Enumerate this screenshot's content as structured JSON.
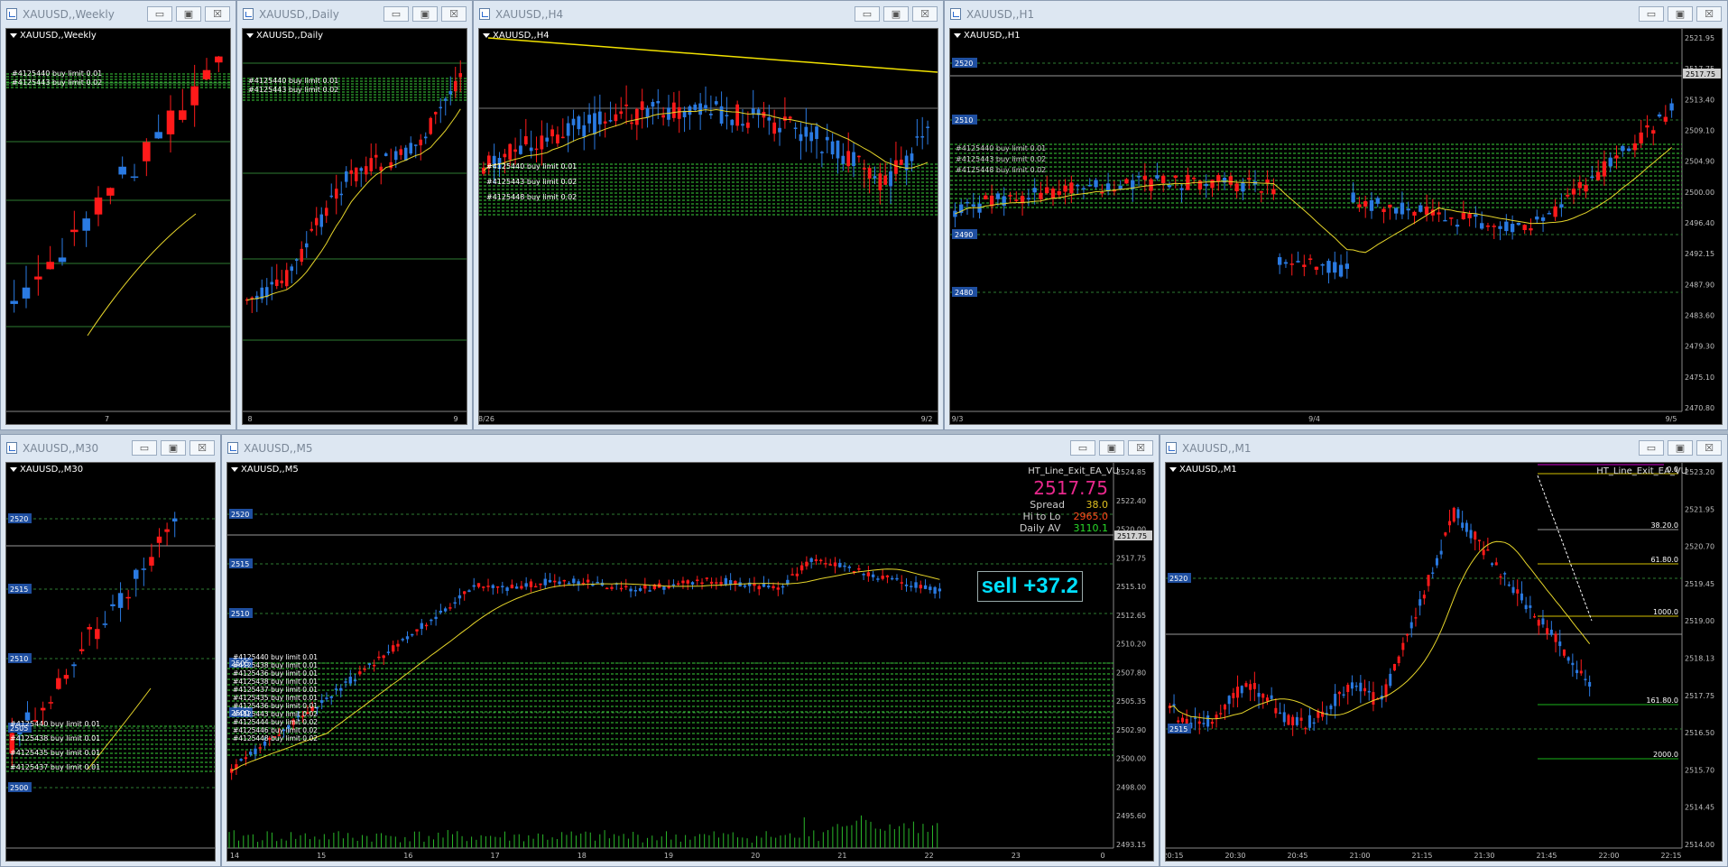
{
  "colors": {
    "bull": "#2a7ae2",
    "bear": "#ff1a1a",
    "grid": "#3a8a3a",
    "ma": "#e6d52a",
    "order_line": "#3aa83a",
    "bg": "#000000",
    "axis_text": "#bfbfbf",
    "price_tag": "#1f4fa0"
  },
  "window_buttons": {
    "minimize": "▭",
    "maximize": "▣",
    "close": "☒"
  },
  "windows": [
    {
      "id": "weekly",
      "title": "XAUUSD,,Weekly",
      "symbol_label": "XAUUSD,,Weekly",
      "x_labels": [
        "7"
      ],
      "has_price_axis": false,
      "order_labels": [
        "#4125440 buy limit 0.01",
        "#4125443 buy limit 0.02"
      ]
    },
    {
      "id": "daily",
      "title": "XAUUSD,,Daily",
      "symbol_label": "XAUUSD,,Daily",
      "x_labels": [
        "8",
        "9"
      ],
      "has_price_axis": false,
      "order_labels": [
        "#4125440 buy limit 0.01",
        "#4125443 buy limit 0.02"
      ]
    },
    {
      "id": "h4",
      "title": "XAUUSD,,H4",
      "symbol_label": "XAUUSD,,H4",
      "x_labels": [
        "8/26",
        "9/2"
      ],
      "has_price_axis": false,
      "order_labels": [
        "#4125440 buy limit 0.01",
        "#4125443 buy limit 0.02",
        "#4125448 buy limit 0.02"
      ]
    },
    {
      "id": "h1",
      "title": "XAUUSD,,H1",
      "symbol_label": "XAUUSD,,H1",
      "x_labels": [
        "9/3",
        "9/4",
        "9/5"
      ],
      "price_ticks": [
        "2521.95",
        "2517.75",
        "2513.40",
        "2509.10",
        "2504.90",
        "2500.00",
        "2496.40",
        "2492.15",
        "2487.90",
        "2483.60",
        "2479.30",
        "2475.10",
        "2470.80"
      ],
      "level_tags": [
        "2520",
        "2510",
        "2490",
        "2480"
      ],
      "current_price": "2517.75",
      "order_labels": [
        "#4125440 buy limit 0.01",
        "#4125443 buy limit 0.02",
        "#4125448 buy limit 0.02"
      ]
    },
    {
      "id": "m30",
      "title": "XAUUSD,,M30",
      "symbol_label": "XAUUSD,,M30",
      "x_labels": [],
      "level_tags": [
        "2520",
        "2515",
        "2510",
        "2505",
        "2500"
      ],
      "order_labels": [
        "#4125440 buy limit 0.01",
        "#4125438 buy limit 0.01",
        "#4125435 buy limit 0.01",
        "#4125437 buy limit 0.01"
      ]
    },
    {
      "id": "m5",
      "title": "XAUUSD,,M5",
      "symbol_label": "XAUUSD,,M5",
      "ea_label": "HT_Line_Exit_EA_VU",
      "big_price": "2517.75",
      "spread_label": "Spread",
      "spread_value": "38.0",
      "hilo_label": "Hi to Lo",
      "hilo_value": "2965.0",
      "dailyav_label": "Daily AV",
      "dailyav_value": "3110.1",
      "position_text": "sell +37.2",
      "x_labels": [
        "14",
        "15",
        "16",
        "17",
        "18",
        "19",
        "20",
        "21",
        "22",
        "23",
        "0"
      ],
      "price_ticks": [
        "2524.85",
        "2522.40",
        "2520.00",
        "2517.75",
        "2515.10",
        "2512.65",
        "2510.20",
        "2507.80",
        "2505.35",
        "2502.90",
        "2500.00",
        "2498.00",
        "2495.60",
        "2493.15"
      ],
      "level_tags": [
        "2520",
        "2515",
        "2510",
        "2505",
        "2500"
      ],
      "current_price": "2517.75",
      "order_labels": [
        "#4125440 buy limit 0.01",
        "#4125438 buy limit 0.01",
        "#4125436 buy limit 0.01",
        "#4125438 buy limit 0.01",
        "#4125437 buy limit 0.01",
        "#4125435 buy limit 0.01",
        "#4125436 buy limit 0.01",
        "#4125443 buy limit 0.02",
        "#4125444 buy limit 0.02",
        "#4125446 buy limit 0.02",
        "#4125448 buy limit 0.02"
      ]
    },
    {
      "id": "m1",
      "title": "XAUUSD,,M1",
      "symbol_label": "XAUUSD,,M1",
      "ea_label": "HT_Line_Exit_EA_VU",
      "fib_labels": [
        "0.0",
        "38.20.0",
        "61.80.0",
        "1000.0",
        "161.80.0",
        "2000.0"
      ],
      "x_labels": [
        "20:15",
        "20:30",
        "20:45",
        "21:00",
        "21:15",
        "21:30",
        "21:45",
        "22:00",
        "22:15"
      ],
      "price_ticks": [
        "2523.20",
        "2521.95",
        "2520.70",
        "2519.45",
        "2519.00",
        "2518.13",
        "2517.75",
        "2516.50",
        "2515.70",
        "2514.45",
        "2514.00"
      ],
      "level_tags": [
        "2520",
        "2515"
      ],
      "current_price": "2517.75"
    }
  ]
}
